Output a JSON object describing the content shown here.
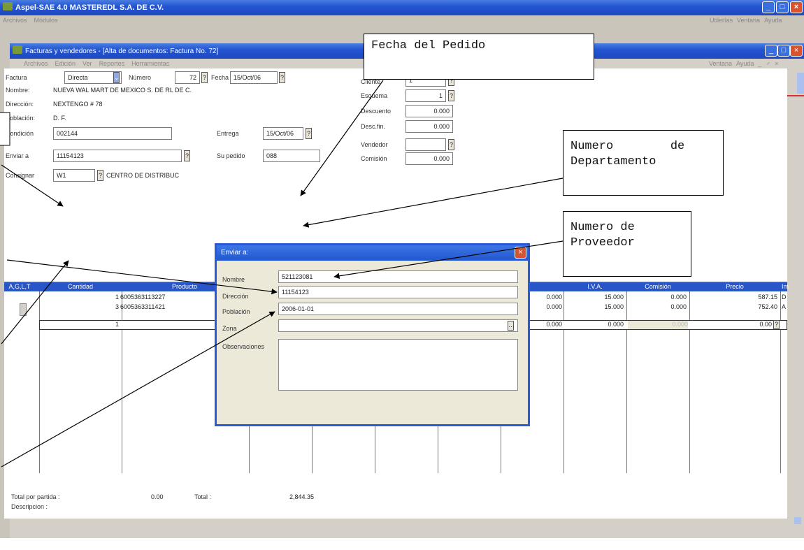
{
  "outer_window": {
    "title": "Aspel-SAE 4.0  MASTEREDL S.A. DE C.V.",
    "menu": [
      "Archivos",
      "Módulos"
    ],
    "menu_right": [
      "Utilerías",
      "Ventana",
      "Ayuda"
    ]
  },
  "inner_window": {
    "title": "Facturas y vendedores - [Alta de documentos: Factura No.       72]",
    "menu": [
      "Archivos",
      "Edición",
      "Ver",
      "Reportes",
      "Herramientas"
    ],
    "menu_right": [
      "Ventana",
      "Ayuda",
      "_",
      "♂",
      "×"
    ]
  },
  "toolbar1": [
    "F",
    "R",
    "P",
    "C",
    "D",
    "A",
    "✉",
    "✎",
    "►"
  ],
  "toolbar2": [
    "▦",
    "▤",
    "▥",
    "✂",
    "❤",
    "≡",
    "≡",
    "⇵",
    "#",
    "▦",
    "⚙",
    "☻",
    "✋",
    "✐",
    "↖"
  ],
  "form": {
    "factura_label": "Factura",
    "factura_value": "Directa",
    "numero_label": "Número",
    "numero_value": "72",
    "fecha_label": "Fecha",
    "fecha_value": "15/Oct/06",
    "nombre_label": "Nombre:",
    "nombre_value": "NUEVA WAL MART DE MEXICO S. DE RL DE C.",
    "direccion_label": "Dirección:",
    "direccion_value": "NEXTENGO # 78",
    "poblacion_label": "Población:",
    "poblacion_value": "D. F.",
    "condicion_label": "Condición",
    "condicion_value": "002144",
    "entrega_label": "Entrega",
    "entrega_value": "15/Oct/06",
    "enviar_label": "Enviar a",
    "enviar_value": "11154123",
    "supedido_label": "Su pedido",
    "supedido_value": "088",
    "consignar_label": "Consignar",
    "consignar_value": "W1",
    "consignar_desc": "CENTRO DE DISTRIBUC",
    "cliente_label": "Cliente",
    "cliente_value": "1",
    "esquema_label": "Esquema",
    "esquema_value": "1",
    "descuento_label": "Descuento",
    "descuento_value": "0.000",
    "descfin_label": "Desc.fin.",
    "descfin_value": "0.000",
    "vendedor_label": "Vendedor",
    "vendedor_value": "",
    "comision_label": "Comisión",
    "comision_value": "0.000"
  },
  "grid": {
    "corner": "A,G,L,T",
    "headers": [
      "Cantidad",
      "Producto",
      "I.V.A.",
      "Comisión",
      "Precio",
      "Im"
    ],
    "rows": [
      {
        "cantidad": "1",
        "producto": "6005363113227",
        "desc": "0.000",
        "iva": "15.000",
        "comision": "0.000",
        "precio": "587.15",
        "im": "D"
      },
      {
        "cantidad": "3",
        "producto": "6005363311421",
        "desc": "0.000",
        "iva": "15.000",
        "comision": "0.000",
        "precio": "752.40",
        "im": "A"
      },
      {
        "cantidad": "1",
        "producto": "",
        "desc": "0.000",
        "iva": "0.000",
        "comision": "0.000",
        "precio": "0.00",
        "im": ""
      }
    ]
  },
  "footer": {
    "total_partida_label": "Total por partida :",
    "total_partida_value": "0.00",
    "total_label": "Total  :",
    "total_value": "2,844.35",
    "descripcion_label": "Descripcion :"
  },
  "dialog": {
    "title": "Enviar a:",
    "nombre_label": "Nombre",
    "nombre_value": "521123081",
    "direccion_label": "Dirección",
    "direccion_value": "11154123",
    "poblacion_label": "Población",
    "poblacion_value": "2006-01-01",
    "zona_label": "Zona",
    "zona_value": "",
    "observaciones_label": "Observaciones",
    "observaciones_value": ""
  },
  "callouts": {
    "fecha_pedido": "Fecha del Pedido",
    "num_depto_1": "Numero        de",
    "num_depto_2": "Departamento",
    "num_prov_1": "Numero de",
    "num_prov_2": "Proveedor"
  }
}
